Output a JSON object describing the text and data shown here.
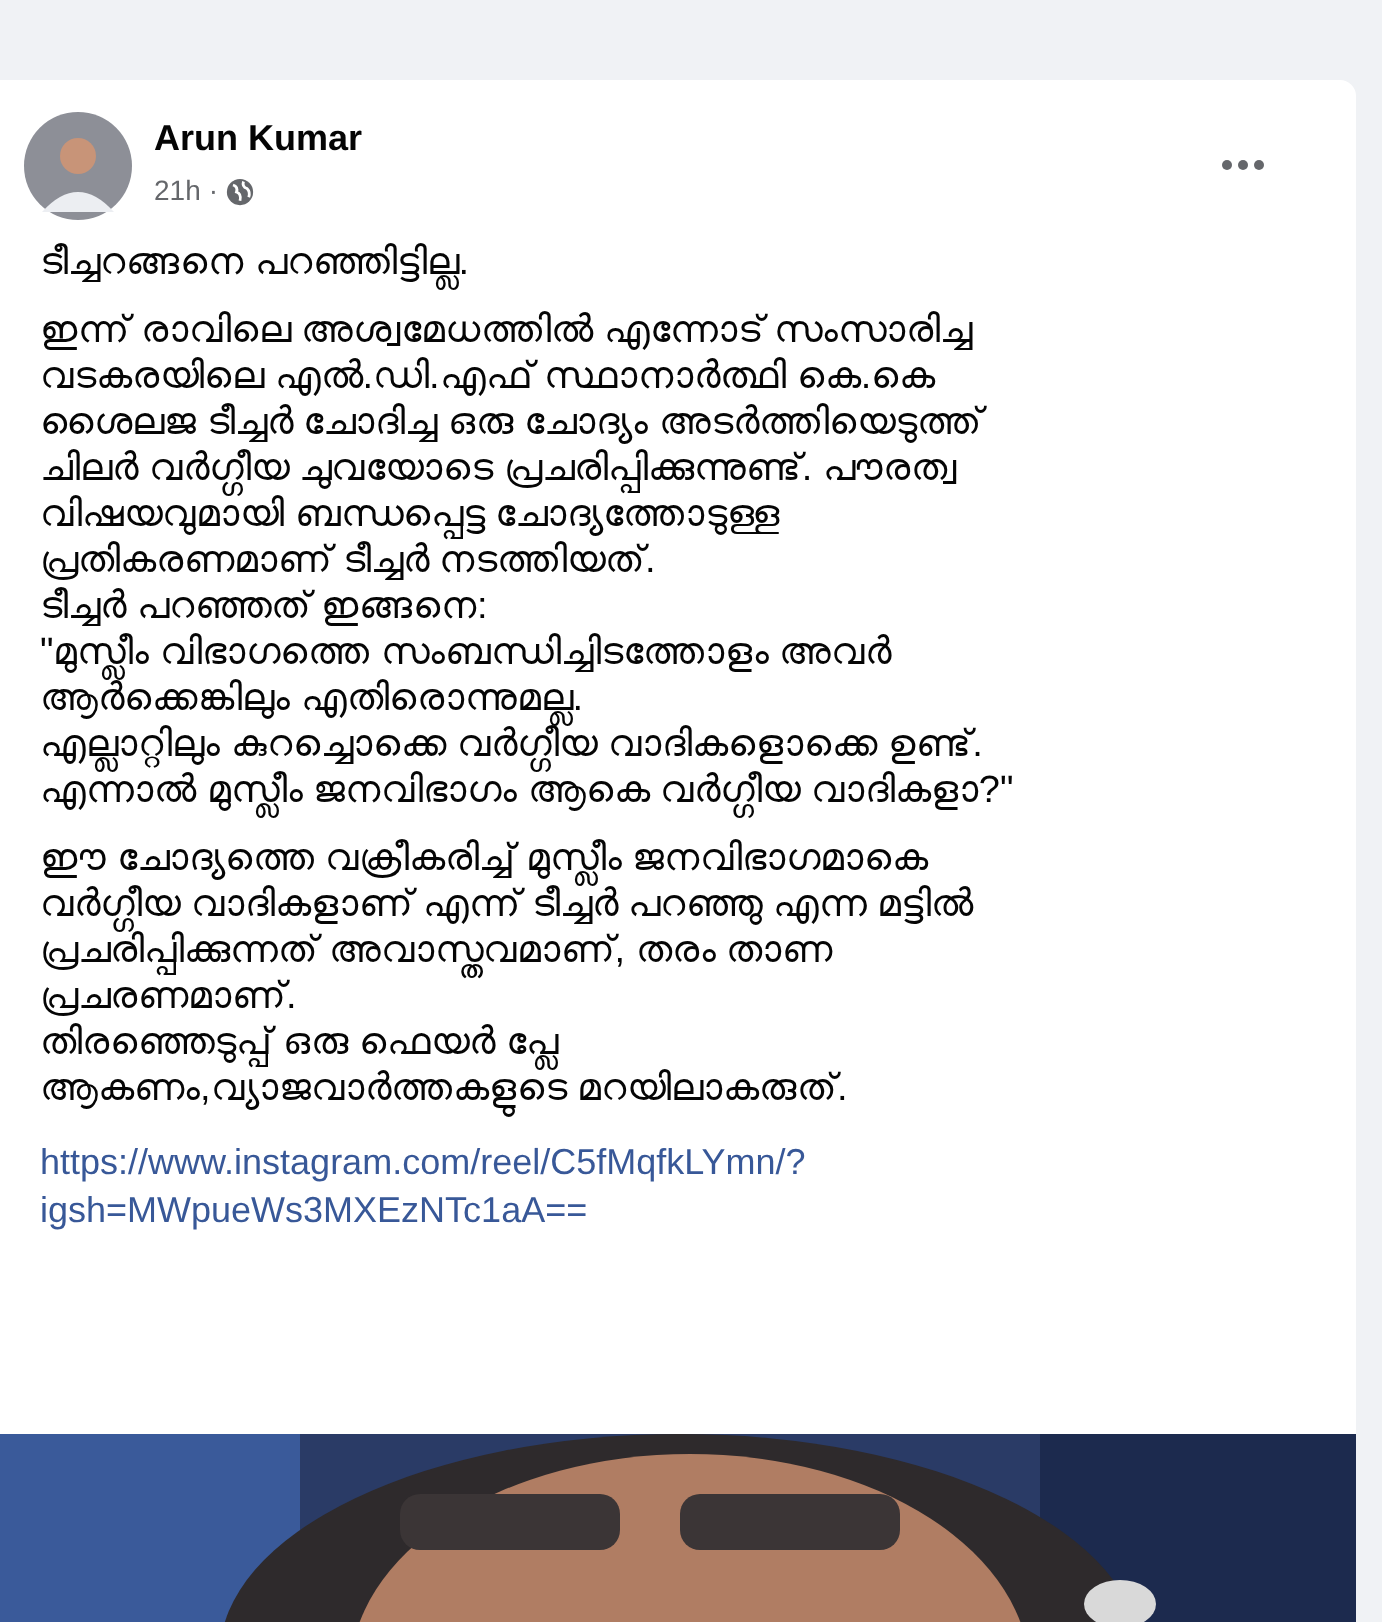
{
  "post": {
    "author": "Arun Kumar",
    "time": "21h",
    "separator": "·",
    "paragraphs": [
      [
        "ടീച്ചറങ്ങനെ പറഞ്ഞിട്ടില്ല."
      ],
      [
        "ഇന്ന് രാവിലെ അശ്വമേധത്തിൽ എന്നോട് സംസാരിച്ച",
        "വടകരയിലെ എൽ.ഡി.എഫ് സ്ഥാനാർത്ഥി കെ.കെ",
        "ശൈലജ ടീച്ചർ ചോദിച്ച ഒരു ചോദ്യം അടർത്തിയെടുത്ത്",
        "ചിലർ വർഗ്ഗീയ ചുവയോടെ പ്രചരിപ്പിക്കുന്നുണ്ട്. പൗരത്വ",
        "വിഷയവുമായി ബന്ധപ്പെട്ട ചോദ്യത്തോടുള്ള",
        "പ്രതികരണമാണ് ടീച്ചർ നടത്തിയത്.",
        "ടീച്ചർ പറഞ്ഞത് ഇങ്ങനെ:",
        "\"മുസ്ലീം വിഭാഗത്തെ സംബന്ധിച്ചിടത്തോളം അവർ",
        "ആർക്കെങ്കിലും എതിരൊന്നുമല്ല.",
        "എല്ലാറ്റിലും കുറച്ചൊക്കെ വർഗ്ഗീയ വാദികളൊക്കെ ഉണ്ട്.",
        "എന്നാൽ മുസ്ലീം ജനവിഭാഗം ആകെ വർഗ്ഗീയ വാദികളാ?\""
      ],
      [
        "ഈ ചോദ്യത്തെ വക്രീകരിച്ച് മുസ്ലീം ജനവിഭാഗമാകെ",
        "വർഗ്ഗീയ വാദികളാണ് എന്ന് ടീച്ചർ പറഞ്ഞു എന്ന മട്ടിൽ",
        "പ്രചരിപ്പിക്കുന്നത് അവാസ്തവമാണ്, തരം താണ",
        "പ്രചരണമാണ്.",
        "തിരഞ്ഞെടുപ്പ് ഒരു ഫെയർ പ്ലേ",
        "ആകണം,വ്യാജവാർത്തകളുടെ മറയിലാകരുത്."
      ]
    ],
    "link": [
      "https://www.instagram.com/reel/C5fMqfkLYmn/?",
      "igsh=MWpueWs3MXEzNTc1aA=="
    ],
    "media": {
      "kind": "picture"
    }
  }
}
